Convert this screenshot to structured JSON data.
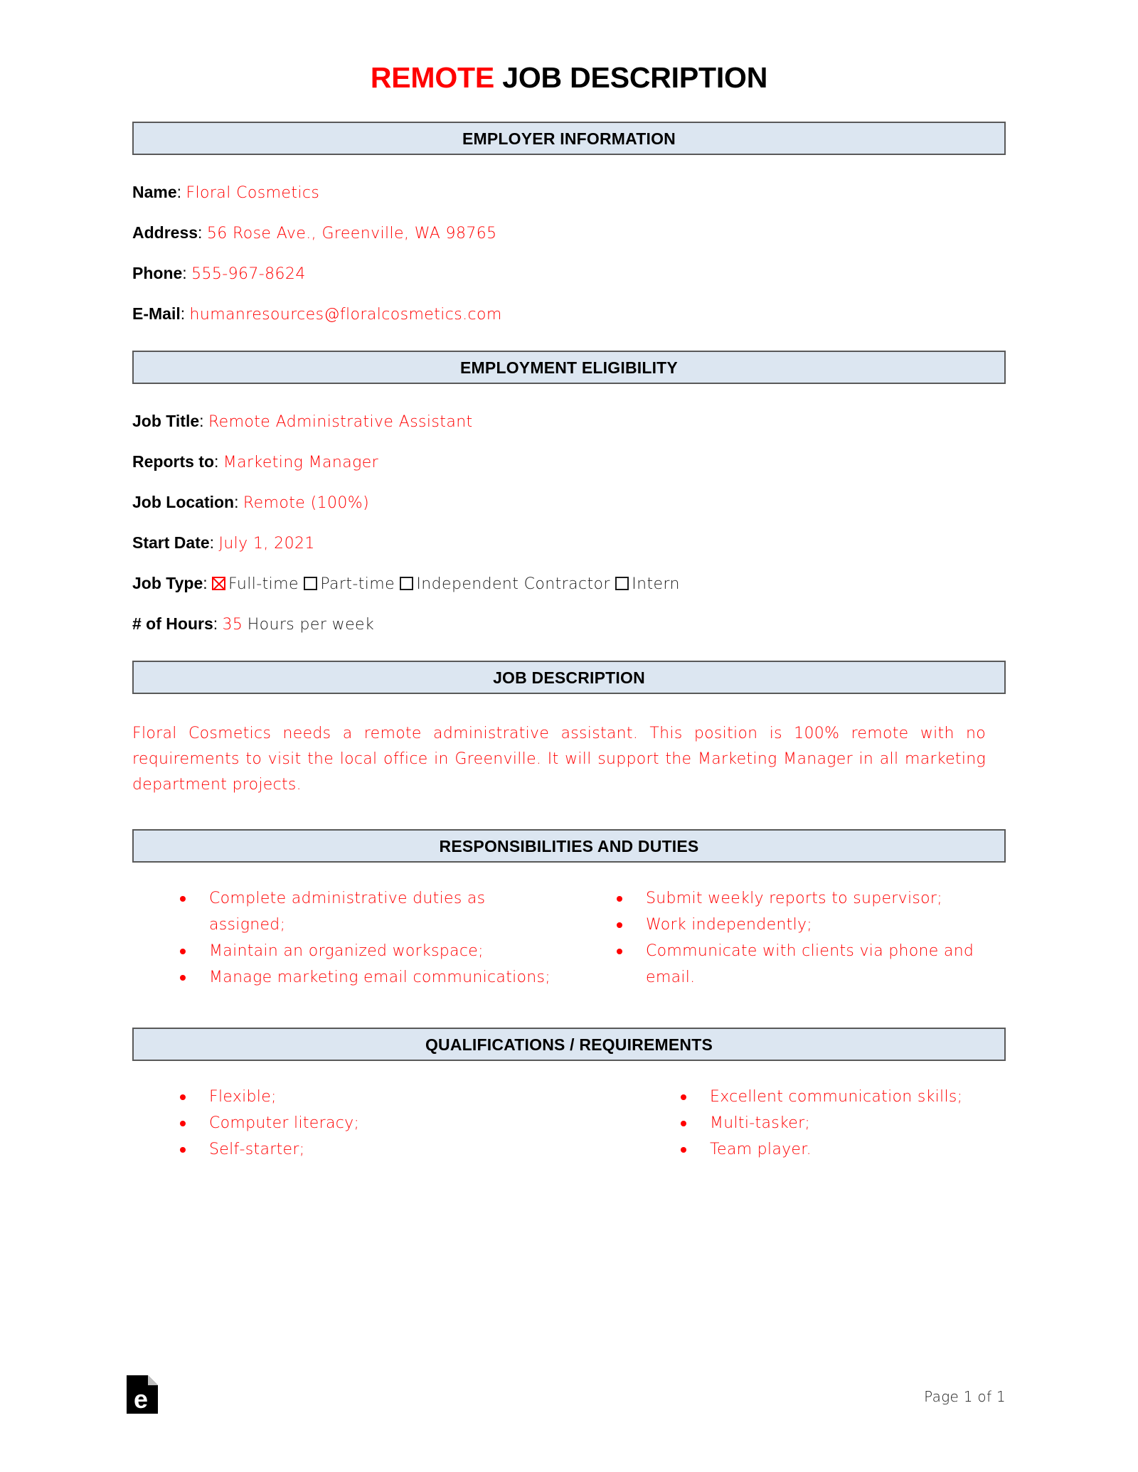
{
  "document": {
    "title_accent": "REMOTE",
    "title_rest": " JOB DESCRIPTION"
  },
  "sections": {
    "employer_information": {
      "heading": "EMPLOYER INFORMATION",
      "fields": [
        {
          "label": "Name",
          "colon": ":",
          "value": "Floral Cosmetics"
        },
        {
          "label": "Address",
          "colon": ":",
          "value": "56 Rose Ave., Greenville, WA 98765"
        },
        {
          "label": "Phone",
          "colon": ":",
          "value": "555-967-8624"
        },
        {
          "label": "E-Mail",
          "colon": ":",
          "value": "humanresources@floralcosmetics.com"
        }
      ]
    },
    "employment_eligibility": {
      "heading": "EMPLOYMENT ELIGIBILITY",
      "fields": [
        {
          "label": "Job Title",
          "colon": ":",
          "value": "Remote Administrative Assistant"
        },
        {
          "label": "Reports to",
          "colon": ":",
          "value": "Marketing Manager"
        },
        {
          "label": "Job Location",
          "colon": ":",
          "value": "Remote (100%)"
        },
        {
          "label": "Start Date",
          "colon": ":",
          "value": "July 1, 2021"
        }
      ],
      "job_type": {
        "label": "Job Type",
        "colon": ":",
        "options": [
          {
            "label": "Full-time",
            "checked": true
          },
          {
            "label": "Part-time",
            "checked": false
          },
          {
            "label": "Independent Contractor",
            "checked": false
          },
          {
            "label": "Intern",
            "checked": false
          }
        ]
      },
      "hours": {
        "label": "# of Hours",
        "colon": ":",
        "value": "35",
        "suffix": "Hours per week"
      }
    },
    "job_description": {
      "heading": "JOB DESCRIPTION",
      "body": "Floral Cosmetics needs a remote administrative assistant. This position is 100% remote with no requirements to visit the local office in Greenville. It will support the Marketing Manager in all marketing department projects."
    },
    "responsibilities": {
      "heading": "RESPONSIBILITIES AND DUTIES",
      "left": [
        "Complete administrative duties as assigned;",
        "Maintain an organized workspace;",
        "Manage marketing email communications;"
      ],
      "right": [
        "Submit weekly reports to supervisor;",
        "Work independently;",
        "Communicate with clients via phone and email."
      ]
    },
    "qualifications": {
      "heading": "QUALIFICATIONS / REQUIREMENTS",
      "left": [
        "Flexible;",
        "Computer literacy;",
        "Self-starter;"
      ],
      "right": [
        "Excellent communication skills;",
        "Multi-tasker;",
        "Team player."
      ]
    }
  },
  "footer": {
    "logo_letter": "e",
    "page_label": "Page 1 of 1"
  },
  "colors": {
    "accent_red": "#ff0000",
    "section_bar_bg": "#dce6f1",
    "section_bar_border": "#595959"
  }
}
